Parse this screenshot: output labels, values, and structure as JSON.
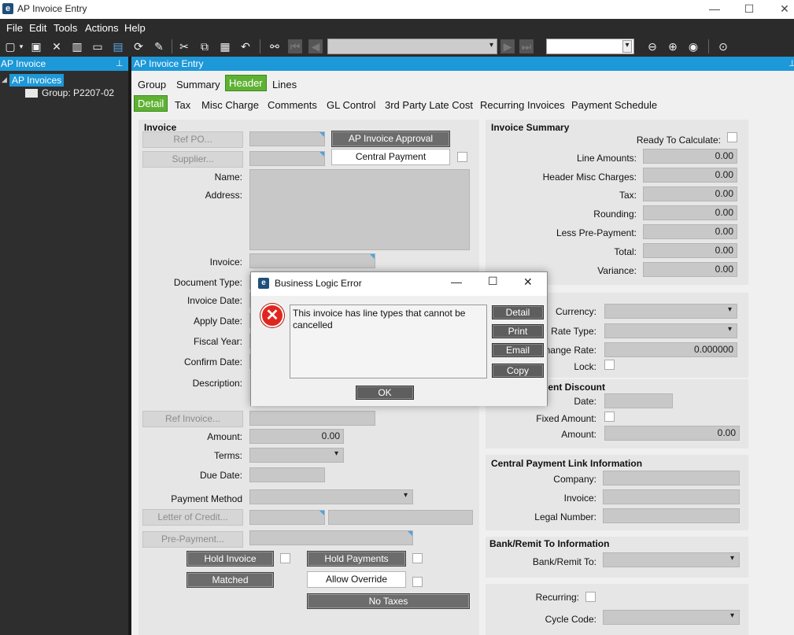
{
  "window": {
    "title": "AP Invoice Entry",
    "app_icon": "e"
  },
  "menu": [
    "File",
    "Edit",
    "Tools",
    "Actions",
    "Help"
  ],
  "left_panel": {
    "header": "AP Invoice",
    "tree_root": "AP Invoices",
    "tree_child": "Group: P2207-02"
  },
  "main_header": "AP Invoice Entry",
  "tabs_top": [
    "Group",
    "Summary",
    "Header",
    "Lines"
  ],
  "tabs_sub": [
    "Detail",
    "Tax",
    "Misc Charge",
    "Comments",
    "GL Control",
    "3rd Party Late Cost",
    "Recurring Invoices",
    "Payment Schedule"
  ],
  "invoice": {
    "group_title": "Invoice",
    "ref_po": "Ref PO...",
    "supplier": "Supplier...",
    "ap_invoice_approval": "AP Invoice Approval",
    "central_payment": "Central Payment",
    "name": "Name:",
    "address": "Address:",
    "invoice": "Invoice:",
    "document_type": "Document Type:",
    "invoice_date": "Invoice Date:",
    "apply_date": "Apply Date:",
    "fiscal_year": "Fiscal Year:",
    "confirm_date": "Confirm Date:",
    "description": "Description:",
    "ref_invoice": "Ref Invoice...",
    "amount": "Amount:",
    "amount_value": "0.00",
    "terms": "Terms:",
    "due_date": "Due Date:",
    "payment_method": "Payment Method",
    "letter_of_credit": "Letter of Credit...",
    "pre_payment": "Pre-Payment...",
    "hold_invoice": "Hold Invoice",
    "hold_payments": "Hold Payments",
    "matched": "Matched",
    "allow_override": "Allow Override",
    "no_taxes": "No Taxes"
  },
  "summary": {
    "title": "Invoice Summary",
    "ready": "Ready To Calculate:",
    "rows": [
      {
        "label": "Line Amounts:",
        "value": "0.00"
      },
      {
        "label": "Header Misc Charges:",
        "value": "0.00"
      },
      {
        "label": "Tax:",
        "value": "0.00"
      },
      {
        "label": "Rounding:",
        "value": "0.00"
      },
      {
        "label": "Less Pre-Payment:",
        "value": "0.00"
      },
      {
        "label": "Total:",
        "value": "0.00"
      },
      {
        "label": "Variance:",
        "value": "0.00"
      }
    ]
  },
  "currency": {
    "currency": "Currency:",
    "rate_type": "Rate Type:",
    "exchange_rate": "hange Rate:",
    "exchange_rate_value": "0.000000",
    "lock": "Lock:"
  },
  "discount": {
    "title": "nent Discount",
    "date": "Date:",
    "fixed_amount": "Fixed Amount:",
    "amount": "Amount:",
    "amount_value": "0.00"
  },
  "central_link": {
    "title": "Central Payment Link Information",
    "company": "Company:",
    "invoice": "Invoice:",
    "legal_number": "Legal Number:"
  },
  "bank": {
    "title": "Bank/Remit To Information",
    "bank_remit": "Bank/Remit To:"
  },
  "recurring": {
    "recurring": "Recurring:",
    "cycle_code": "Cycle Code:"
  },
  "dialog": {
    "title": "Business Logic Error",
    "message": "This invoice has line types that cannot be cancelled",
    "buttons": [
      "Detail",
      "Print",
      "Email",
      "Copy"
    ],
    "ok": "OK"
  }
}
